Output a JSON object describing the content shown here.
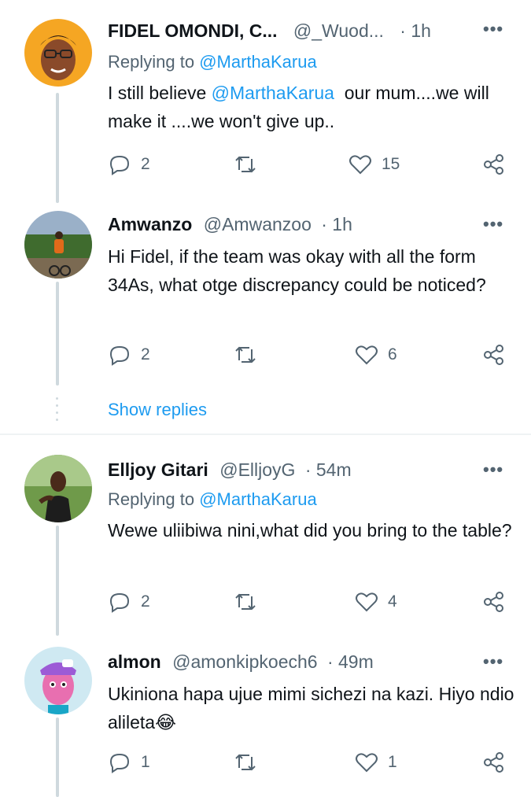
{
  "tweets": [
    {
      "name": "FIDEL OMONDI, C...",
      "handle": "@_Wuod...",
      "time": "· 1h",
      "replying_label": "Replying to ",
      "replying_to": "@MarthaKarua",
      "body_pre": "I still believe ",
      "body_mention": "@MarthaKarua",
      "body_post": "  our mum....we will make it ....we won't give up..",
      "replies": "2",
      "retweets": "",
      "likes": "15"
    },
    {
      "name": "Amwanzo",
      "handle": "@Amwanzoo",
      "time": "· 1h",
      "body": "Hi Fidel, if the team was okay with all the form 34As, what otge discrepancy could be noticed?",
      "replies": "2",
      "retweets": "",
      "likes": "6"
    },
    {
      "name": "Elljoy Gitari",
      "handle": "@ElljoyG",
      "time": "· 54m",
      "replying_label": "Replying to ",
      "replying_to": "@MarthaKarua",
      "body": "Wewe uliibiwa nini,what did you bring to the table?",
      "replies": "2",
      "retweets": "",
      "likes": "4"
    },
    {
      "name": "almon",
      "handle": "@amonkipkoech6",
      "time": "· 49m",
      "body": "Ukiniona hapa ujue mimi sichezi na kazi. Hiyo ndio alileta😂",
      "replies": "1",
      "retweets": "",
      "likes": "1"
    }
  ],
  "show_replies": "Show replies",
  "more_glyph": "•••",
  "icons": {
    "reply": "reply-icon",
    "retweet": "retweet-icon",
    "like": "heart-icon",
    "share": "share-icon"
  },
  "colors": {
    "accent": "#1d9bf0",
    "secondary_text": "#536471",
    "thread_line": "#cfd9de"
  }
}
